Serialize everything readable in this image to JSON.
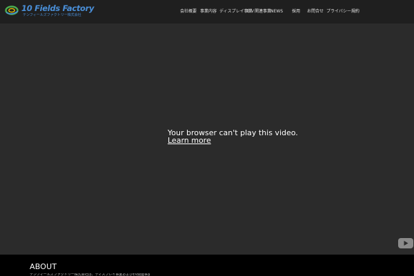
{
  "header": {
    "logo": {
      "name": "10 Fields Factory",
      "subtitle": "テンフィールズファクトリー株式会社",
      "icon": "ring-logo-icon"
    },
    "nav": [
      {
        "label": "会社概要"
      },
      {
        "label": "事業内容"
      },
      {
        "label": "ディスプレイ事業"
      },
      {
        "label": "ＥＶ関連事業"
      },
      {
        "label": "NEWS"
      },
      {
        "label": "採用"
      },
      {
        "label": "お問合せ"
      },
      {
        "label": "プライバシー規約"
      }
    ]
  },
  "video": {
    "message": "Your browser can't play this video.",
    "link": "Learn more",
    "play_icon": "youtube-play-icon"
  },
  "about": {
    "title": "ABOUT",
    "text": "テンフィールズファクトリー株式会社は、ディスプレイ事業およびEV関連事業を展開しています。"
  },
  "colors": {
    "header_bg": "#1f1f1f",
    "video_bg": "#2b2b2b",
    "logo_blue": "#4a8fd8",
    "logo_green": "#4caf50",
    "logo_yellow": "#f2c200"
  }
}
